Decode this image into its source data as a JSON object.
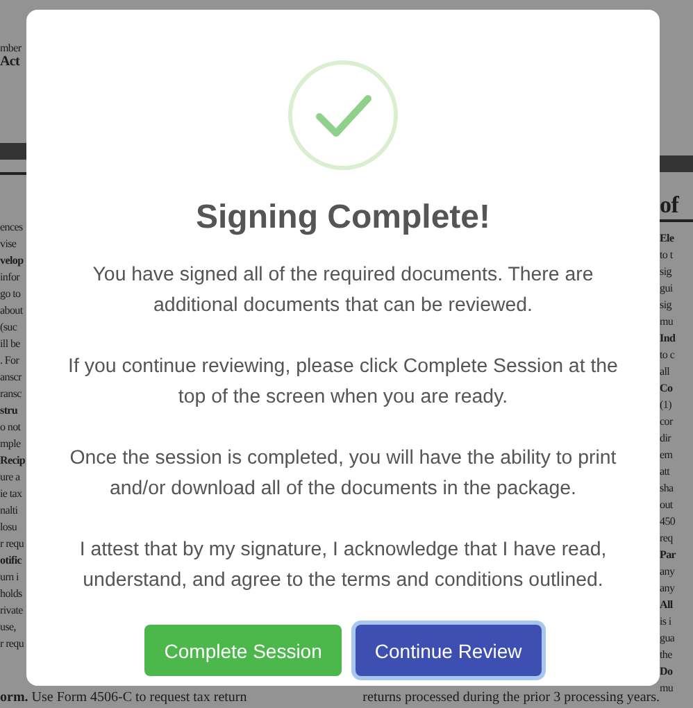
{
  "document": {
    "left_header": [
      "mber",
      "Act"
    ],
    "left_lines": [
      {
        "text": "ences",
        "bold": false
      },
      {
        "text": "vise",
        "bold": false
      },
      {
        "text": "velop",
        "bold": true
      },
      {
        "text": "infor",
        "bold": false
      },
      {
        "text": "go to",
        "bold": false
      },
      {
        "text": "about",
        "bold": false
      },
      {
        "text": "(suc",
        "bold": false
      },
      {
        "text": "ill be",
        "bold": false
      },
      {
        "text": ". For",
        "bold": false
      },
      {
        "text": "anscr",
        "bold": false
      },
      {
        "text": "ransc",
        "bold": false
      },
      {
        "text": "stru",
        "bold": true
      },
      {
        "text": "o not",
        "bold": false
      },
      {
        "text": "mple",
        "bold": false
      },
      {
        "text": "Recip",
        "bold": true
      },
      {
        "text": "ure a",
        "bold": false
      },
      {
        "text": "ie tax",
        "bold": false
      },
      {
        "text": "nalti",
        "bold": false
      },
      {
        "text": "losu",
        "bold": false
      },
      {
        "text": "r requ",
        "bold": false
      },
      {
        "text": "otific",
        "bold": true
      },
      {
        "text": "urn i",
        "bold": false
      },
      {
        "text": "holds",
        "bold": false
      },
      {
        "text": "rivate",
        "bold": false
      },
      {
        "text": "use,",
        "bold": false
      },
      {
        "text": "r requ",
        "bold": false
      }
    ],
    "right_header": "of",
    "right_lines": [
      {
        "text": "Ele",
        "bold": true
      },
      {
        "text": "to t",
        "bold": false
      },
      {
        "text": "sig",
        "bold": false
      },
      {
        "text": "gui",
        "bold": false
      },
      {
        "text": "sig",
        "bold": false
      },
      {
        "text": "mu",
        "bold": false
      },
      {
        "text": "Ind",
        "bold": true
      },
      {
        "text": "to c",
        "bold": false
      },
      {
        "text": "all",
        "bold": false
      },
      {
        "text": "Co",
        "bold": true
      },
      {
        "text": "(1)",
        "bold": false
      },
      {
        "text": "cor",
        "bold": false
      },
      {
        "text": "dir",
        "bold": false
      },
      {
        "text": "em",
        "bold": false
      },
      {
        "text": "att",
        "bold": false
      },
      {
        "text": "sha",
        "bold": false
      },
      {
        "text": "out",
        "bold": false
      },
      {
        "text": "450",
        "bold": false
      },
      {
        "text": "req",
        "bold": false
      },
      {
        "text": "Par",
        "bold": true
      },
      {
        "text": "any",
        "bold": false
      },
      {
        "text": "any",
        "bold": false
      },
      {
        "text": "All",
        "bold": true
      },
      {
        "text": "is i",
        "bold": false
      },
      {
        "text": "gua",
        "bold": false
      },
      {
        "text": "the",
        "bold": false
      },
      {
        "text": "Do",
        "bold": true
      },
      {
        "text": "mu",
        "bold": false
      }
    ],
    "bottom_left": "**orm.** Use Form 4506-C to request tax return",
    "bottom_right": "returns processed during the prior 3 processing years."
  },
  "modal": {
    "title": "Signing Complete!",
    "paragraphs": [
      "You have signed all of the required documents. There are additional documents that can be reviewed.",
      "If you continue reviewing, please click Complete Session at the top of the screen when you are ready.",
      "Once the session is completed, you will have the ability to print and/or download all of the documents in the package.",
      "I attest that by my signature, I acknowledge that I have read, understand, and agree to the terms and conditions outlined."
    ],
    "buttons": [
      {
        "label": "Complete Session",
        "kind": "success",
        "focused": false
      },
      {
        "label": "Continue Review",
        "kind": "primary",
        "focused": true
      }
    ]
  }
}
